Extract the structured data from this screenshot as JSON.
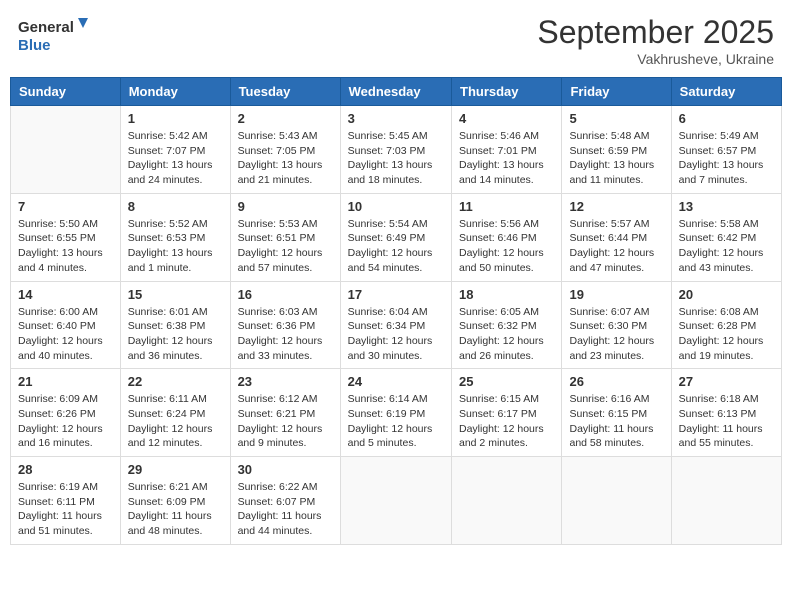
{
  "header": {
    "logo_general": "General",
    "logo_blue": "Blue",
    "month_title": "September 2025",
    "subtitle": "Vakhrusheve, Ukraine"
  },
  "days_of_week": [
    "Sunday",
    "Monday",
    "Tuesday",
    "Wednesday",
    "Thursday",
    "Friday",
    "Saturday"
  ],
  "weeks": [
    [
      {
        "day": "",
        "info": ""
      },
      {
        "day": "1",
        "info": "Sunrise: 5:42 AM\nSunset: 7:07 PM\nDaylight: 13 hours\nand 24 minutes."
      },
      {
        "day": "2",
        "info": "Sunrise: 5:43 AM\nSunset: 7:05 PM\nDaylight: 13 hours\nand 21 minutes."
      },
      {
        "day": "3",
        "info": "Sunrise: 5:45 AM\nSunset: 7:03 PM\nDaylight: 13 hours\nand 18 minutes."
      },
      {
        "day": "4",
        "info": "Sunrise: 5:46 AM\nSunset: 7:01 PM\nDaylight: 13 hours\nand 14 minutes."
      },
      {
        "day": "5",
        "info": "Sunrise: 5:48 AM\nSunset: 6:59 PM\nDaylight: 13 hours\nand 11 minutes."
      },
      {
        "day": "6",
        "info": "Sunrise: 5:49 AM\nSunset: 6:57 PM\nDaylight: 13 hours\nand 7 minutes."
      }
    ],
    [
      {
        "day": "7",
        "info": "Sunrise: 5:50 AM\nSunset: 6:55 PM\nDaylight: 13 hours\nand 4 minutes."
      },
      {
        "day": "8",
        "info": "Sunrise: 5:52 AM\nSunset: 6:53 PM\nDaylight: 13 hours\nand 1 minute."
      },
      {
        "day": "9",
        "info": "Sunrise: 5:53 AM\nSunset: 6:51 PM\nDaylight: 12 hours\nand 57 minutes."
      },
      {
        "day": "10",
        "info": "Sunrise: 5:54 AM\nSunset: 6:49 PM\nDaylight: 12 hours\nand 54 minutes."
      },
      {
        "day": "11",
        "info": "Sunrise: 5:56 AM\nSunset: 6:46 PM\nDaylight: 12 hours\nand 50 minutes."
      },
      {
        "day": "12",
        "info": "Sunrise: 5:57 AM\nSunset: 6:44 PM\nDaylight: 12 hours\nand 47 minutes."
      },
      {
        "day": "13",
        "info": "Sunrise: 5:58 AM\nSunset: 6:42 PM\nDaylight: 12 hours\nand 43 minutes."
      }
    ],
    [
      {
        "day": "14",
        "info": "Sunrise: 6:00 AM\nSunset: 6:40 PM\nDaylight: 12 hours\nand 40 minutes."
      },
      {
        "day": "15",
        "info": "Sunrise: 6:01 AM\nSunset: 6:38 PM\nDaylight: 12 hours\nand 36 minutes."
      },
      {
        "day": "16",
        "info": "Sunrise: 6:03 AM\nSunset: 6:36 PM\nDaylight: 12 hours\nand 33 minutes."
      },
      {
        "day": "17",
        "info": "Sunrise: 6:04 AM\nSunset: 6:34 PM\nDaylight: 12 hours\nand 30 minutes."
      },
      {
        "day": "18",
        "info": "Sunrise: 6:05 AM\nSunset: 6:32 PM\nDaylight: 12 hours\nand 26 minutes."
      },
      {
        "day": "19",
        "info": "Sunrise: 6:07 AM\nSunset: 6:30 PM\nDaylight: 12 hours\nand 23 minutes."
      },
      {
        "day": "20",
        "info": "Sunrise: 6:08 AM\nSunset: 6:28 PM\nDaylight: 12 hours\nand 19 minutes."
      }
    ],
    [
      {
        "day": "21",
        "info": "Sunrise: 6:09 AM\nSunset: 6:26 PM\nDaylight: 12 hours\nand 16 minutes."
      },
      {
        "day": "22",
        "info": "Sunrise: 6:11 AM\nSunset: 6:24 PM\nDaylight: 12 hours\nand 12 minutes."
      },
      {
        "day": "23",
        "info": "Sunrise: 6:12 AM\nSunset: 6:21 PM\nDaylight: 12 hours\nand 9 minutes."
      },
      {
        "day": "24",
        "info": "Sunrise: 6:14 AM\nSunset: 6:19 PM\nDaylight: 12 hours\nand 5 minutes."
      },
      {
        "day": "25",
        "info": "Sunrise: 6:15 AM\nSunset: 6:17 PM\nDaylight: 12 hours\nand 2 minutes."
      },
      {
        "day": "26",
        "info": "Sunrise: 6:16 AM\nSunset: 6:15 PM\nDaylight: 11 hours\nand 58 minutes."
      },
      {
        "day": "27",
        "info": "Sunrise: 6:18 AM\nSunset: 6:13 PM\nDaylight: 11 hours\nand 55 minutes."
      }
    ],
    [
      {
        "day": "28",
        "info": "Sunrise: 6:19 AM\nSunset: 6:11 PM\nDaylight: 11 hours\nand 51 minutes."
      },
      {
        "day": "29",
        "info": "Sunrise: 6:21 AM\nSunset: 6:09 PM\nDaylight: 11 hours\nand 48 minutes."
      },
      {
        "day": "30",
        "info": "Sunrise: 6:22 AM\nSunset: 6:07 PM\nDaylight: 11 hours\nand 44 minutes."
      },
      {
        "day": "",
        "info": ""
      },
      {
        "day": "",
        "info": ""
      },
      {
        "day": "",
        "info": ""
      },
      {
        "day": "",
        "info": ""
      }
    ]
  ]
}
